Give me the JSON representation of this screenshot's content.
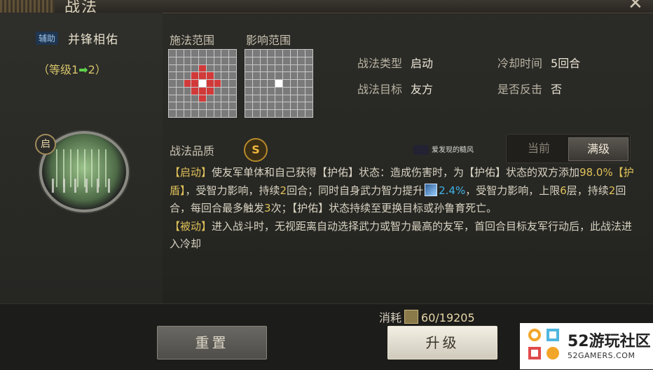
{
  "window": {
    "title": "战法",
    "close": "✕"
  },
  "skill": {
    "role_tag": "辅助",
    "name": "并锋相佑",
    "level_prefix": "（等级1",
    "level_arrow": "➡",
    "level_suffix": "2）",
    "icon_badge": "启"
  },
  "ranges": {
    "cast_label": "施法范围",
    "effect_label": "影响范围",
    "cast_grid_red": [
      [
        2,
        4
      ],
      [
        3,
        3
      ],
      [
        3,
        4
      ],
      [
        3,
        5
      ],
      [
        4,
        2
      ],
      [
        4,
        3
      ],
      [
        4,
        5
      ],
      [
        4,
        6
      ],
      [
        5,
        3
      ],
      [
        5,
        4
      ],
      [
        5,
        5
      ],
      [
        6,
        4
      ]
    ],
    "cast_grid_white": [
      [
        4,
        4
      ]
    ],
    "effect_grid_white": [
      [
        4,
        4
      ]
    ]
  },
  "info": {
    "type_label": "战法类型",
    "type_value": "启动",
    "cooldown_label": "冷却时间",
    "cooldown_value": "5回合",
    "target_label": "战法目标",
    "target_value": "友方",
    "counter_label": "是否反击",
    "counter_value": "否"
  },
  "quality": {
    "label": "战法品质",
    "grade": "S"
  },
  "watermark": "爱发现的糙风",
  "toggle": {
    "current": "当前",
    "max": "满级",
    "selected": "max"
  },
  "description": {
    "p1_tag": "【启动】",
    "p1_a": "使友军单体和自己获得",
    "p1_b": "【护佑】",
    "p1_c": "状态：造成伤害时，为【护佑】状态的双方添加",
    "p1_num1": "98.0%",
    "p1_d": "【护盾】",
    "p1_e": "，受智力影响，持续",
    "p1_num2": "2",
    "p1_f": "回合；同时自身武力智力提升",
    "p1_pct": "2.4%",
    "p1_g": "，受智力影响，上限",
    "p1_num3": "6",
    "p1_h": "层，持续",
    "p1_num4": "2",
    "p1_i": "回合，每回合最多触发",
    "p1_num5": "3",
    "p1_j": "次；【护佑】状态持续至更换目标或孙鲁育死亡。",
    "p2_tag": "【被动】",
    "p2_a": "进入战斗时，无视距离自动选择武力或智力最高的友军，首回合目标友军行动后，此战法进入冷却"
  },
  "cost": {
    "label": "消耗",
    "value": "60/19205"
  },
  "buttons": {
    "reset": "重置",
    "upgrade": "升级"
  },
  "brand": {
    "name": "52游玩社区",
    "url": "52GAMERS.COM"
  },
  "colors": {
    "accent_gold": "#e0c25a",
    "range_red": "#d23a3a",
    "pct_blue": "#3fb4e8"
  }
}
